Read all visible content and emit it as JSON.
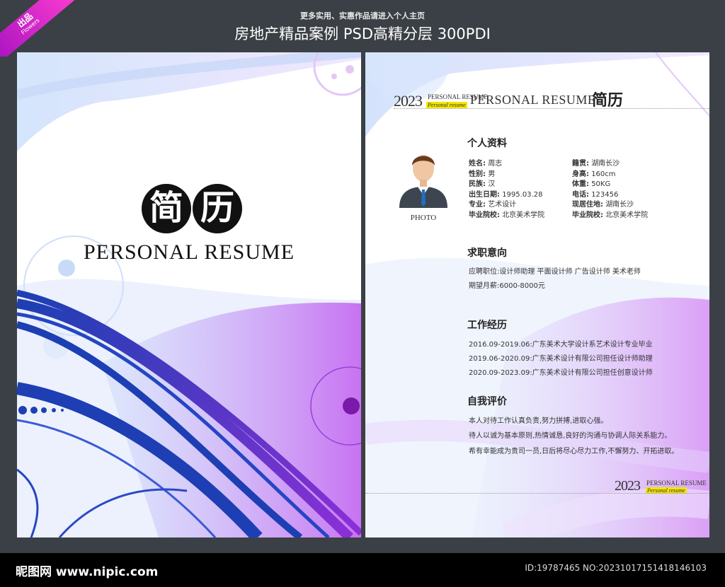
{
  "badge": {
    "text": "出品",
    "sub": "Flowers"
  },
  "header": {
    "subtitle": "更多实用、实惠作品请进入个人主页",
    "title": "房地产精品案例 PSD高精分层 300PDI"
  },
  "cover": {
    "title_chars": [
      "简",
      "历"
    ],
    "subtitle": "PERSONAL RESUME"
  },
  "resume": {
    "year": "2023",
    "year_label": "PERSONAL RESUME",
    "year_tag": "Personal resume",
    "title_en": "PERSONAL RESUME",
    "title_cn": "简历",
    "photo_label": "PHOTO",
    "personal": {
      "heading": "个人资料",
      "left": [
        {
          "key": "姓名:",
          "val": "周志"
        },
        {
          "key": "性别:",
          "val": "男"
        },
        {
          "key": "民族:",
          "val": "汉"
        },
        {
          "key": "出生日期:",
          "val": "1995.03.28"
        },
        {
          "key": "专业:",
          "val": "艺术设计"
        },
        {
          "key": "毕业院校:",
          "val": "北京美术学院"
        }
      ],
      "right": [
        {
          "key": "籍贯:",
          "val": "湖南长沙"
        },
        {
          "key": "身高:",
          "val": "160cm"
        },
        {
          "key": "体重:",
          "val": "50KG"
        },
        {
          "key": "电话:",
          "val": "123456"
        },
        {
          "key": "现居住地:",
          "val": "湖南长沙"
        },
        {
          "key": "毕业院校:",
          "val": "北京美术学院"
        }
      ]
    },
    "intent": {
      "heading": "求职意向",
      "lines": [
        "应聘职位:设计师助理  平面设计师  广告设计师  美术老师",
        "期望月薪:6000-8000元"
      ]
    },
    "experience": {
      "heading": "工作经历",
      "lines": [
        "2016.09-2019.06:广东美术大学设计系艺术设计专业毕业",
        "2019.06-2020.09:广东美术设计有限公司担任设计师助理",
        "2020.09-2023.09:广东美术设计有限公司担任创意设计师"
      ]
    },
    "self": {
      "heading": "自我评价",
      "lines": [
        "本人对待工作认真负责,努力拼搏,进取心强。",
        "待人以诚为基本原则,热情诚恳,良好的沟通与协调人际关系能力。",
        "希有幸能成为贵司一员,日后将尽心尽力工作,不懈努力、开拓进取。"
      ]
    }
  },
  "footer": {
    "logo": "昵图网 www.nipic.com",
    "id": "ID:19787465 NO:20231017151418146103"
  },
  "colors": {
    "background": "#3b4046",
    "accent_purple": "#9b3fd8",
    "accent_blue": "#1d3fb3",
    "tag_yellow": "#f3e600"
  }
}
